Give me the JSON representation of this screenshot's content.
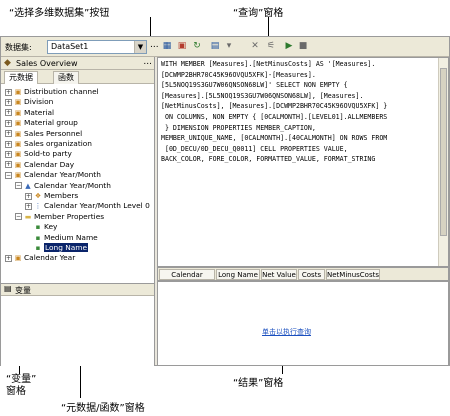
{
  "callouts": {
    "select_dataset": "“选择多维数据集”按钮",
    "query_pane": "“查询”窗格",
    "variables_pane": "“变量”\n窗格",
    "metadata_pane": "“元数据/函数”窗格",
    "results_pane": "“结果”窗格"
  },
  "toolbar": {
    "dataset_label": "数据集:",
    "dataset_value": "DataSet1",
    "browse_label": "...",
    "icons": [
      "cube-select-icon",
      "import-icon",
      "refresh-icon",
      "design-mode-icon",
      "filter-icon",
      "delete-icon",
      "auto-execute-icon",
      "run-icon",
      "stop-icon"
    ]
  },
  "metadata": {
    "cube_name": "Sales Overview",
    "cube_browse": "...",
    "tabs": [
      "元数据",
      "函数"
    ],
    "tree": [
      {
        "label": "Distribution channel",
        "level": 0,
        "expander": "+",
        "icon": "dimension-icon"
      },
      {
        "label": "Division",
        "level": 0,
        "expander": "+",
        "icon": "dimension-icon"
      },
      {
        "label": "Material",
        "level": 0,
        "expander": "+",
        "icon": "dimension-icon"
      },
      {
        "label": "Material group",
        "level": 0,
        "expander": "+",
        "icon": "dimension-icon"
      },
      {
        "label": "Sales Personnel",
        "level": 0,
        "expander": "+",
        "icon": "dimension-icon"
      },
      {
        "label": "Sales organization",
        "level": 0,
        "expander": "+",
        "icon": "dimension-icon"
      },
      {
        "label": "Sold-to party",
        "level": 0,
        "expander": "+",
        "icon": "dimension-icon"
      },
      {
        "label": "Calendar Day",
        "level": 0,
        "expander": "+",
        "icon": "dimension-icon"
      },
      {
        "label": "Calendar Year/Month",
        "level": 0,
        "expander": "−",
        "icon": "dimension-icon"
      },
      {
        "label": "Calendar Year/Month",
        "level": 1,
        "expander": "−",
        "icon": "hierarchy-icon"
      },
      {
        "label": "Members",
        "level": 2,
        "expander": "+",
        "icon": "members-icon"
      },
      {
        "label": "Calendar Year/Month Level 0",
        "level": 2,
        "expander": "+",
        "icon": "level-icon"
      },
      {
        "label": "Member Properties",
        "level": 1,
        "expander": "−",
        "icon": "folder-icon"
      },
      {
        "label": "Key",
        "level": 2,
        "expander": "",
        "icon": "property-icon"
      },
      {
        "label": "Medium Name",
        "level": 2,
        "expander": "",
        "icon": "property-icon"
      },
      {
        "label": "Long Name",
        "level": 2,
        "expander": "",
        "icon": "property-icon",
        "selected": true
      },
      {
        "label": "Calendar Year",
        "level": 0,
        "expander": "+",
        "icon": "dimension-icon"
      }
    ]
  },
  "variables": {
    "title": "变量"
  },
  "query": {
    "text": "WITH MEMBER [Measures].[NetMinusCosts] AS '[Measures].\n[DCWMP2BHR70C45K96OVQU5XFK]-[Measures].\n[5L5NOQ19S3GU7W06QNSON68LW]' SELECT NON EMPTY {\n[Measures].[5L5NOQ19S3GU7W06QNSON68LW], [Measures].\n[NetMinusCosts], [Measures].[DCWMP2BHR70C45K96OVQU5XFK] }\n ON COLUMNS, NON EMPTY { [0CALMONTH].[LEVEL01].ALLMEMBERS\n } DIMENSION PROPERTIES MEMBER_CAPTION,\nMEMBER_UNIQUE_NAME, [0CALMONTH].[40CALMONTH] ON ROWS FROM\n [0D_DECU/0D_DECU_Q0011] CELL PROPERTIES VALUE,\nBACK_COLOR, FORE_COLOR, FORMATTED_VALUE, FORMAT_STRING"
  },
  "columns": [
    "Calendar Year/...",
    "Long Name",
    "Net Value",
    "Costs",
    "NetMinusCosts"
  ],
  "results": {
    "run_link": "单击以执行查询"
  }
}
